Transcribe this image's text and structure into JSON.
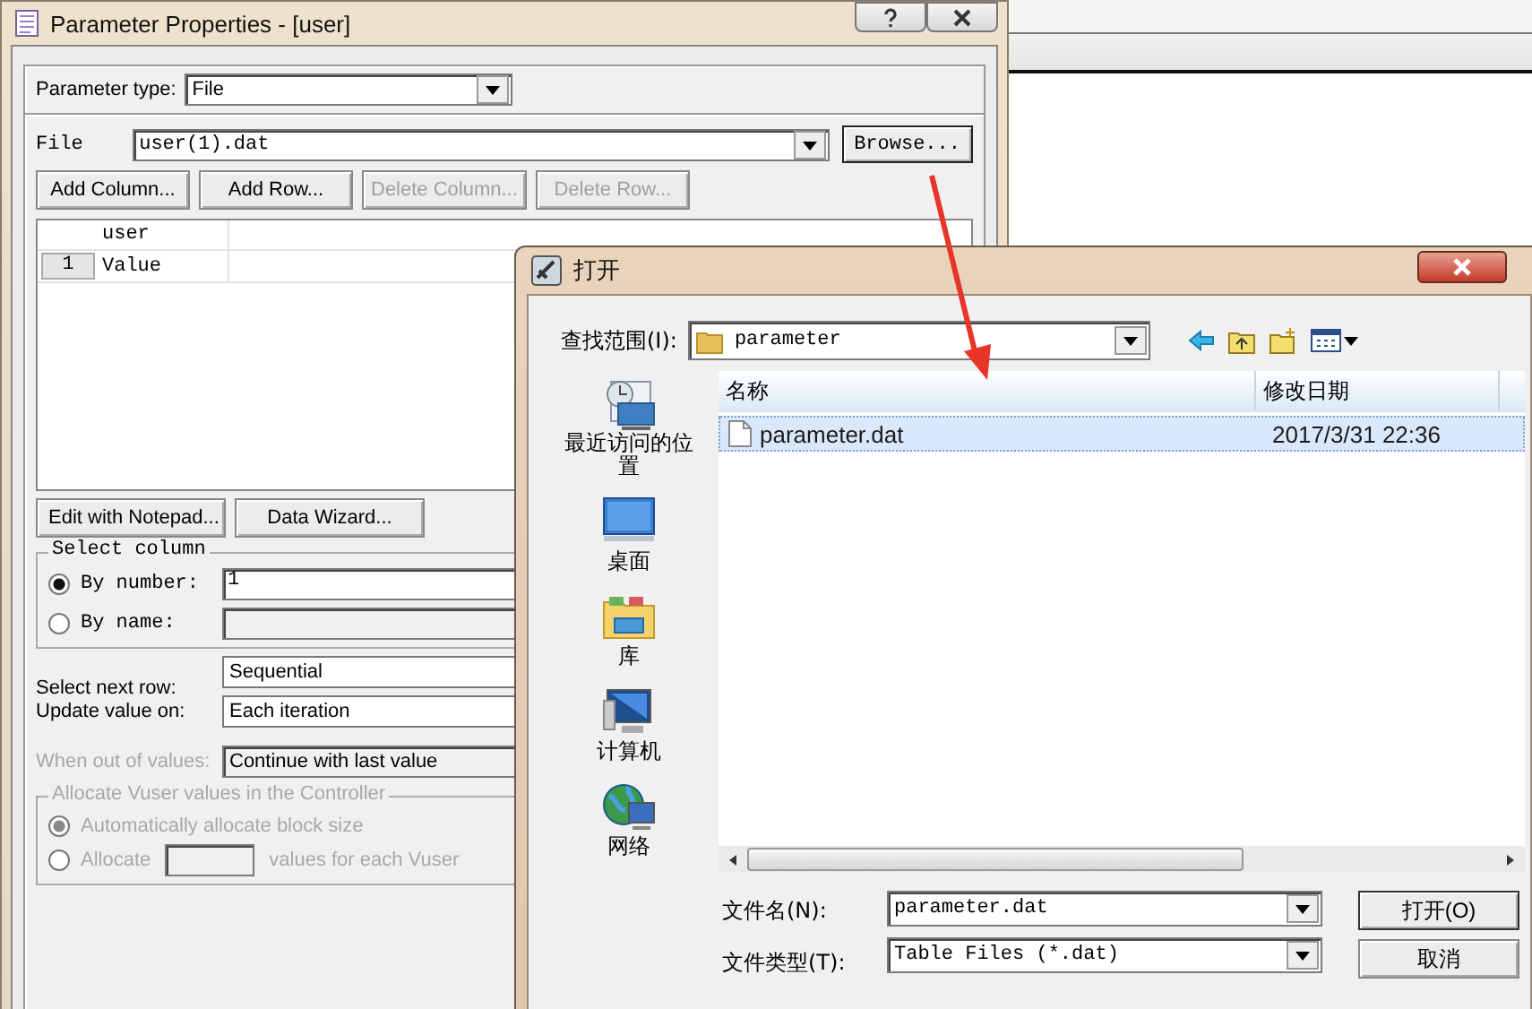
{
  "param_window": {
    "title": "Parameter Properties - [user]",
    "parameter_type": {
      "label": "Parameter type:",
      "value": "File"
    },
    "file": {
      "label": "File",
      "value": "user(1).dat",
      "browse": "Browse..."
    },
    "table_buttons": [
      {
        "label": "Add Column...",
        "disabled": false
      },
      {
        "label": "Add Row...",
        "disabled": false
      },
      {
        "label": "Delete Column...",
        "disabled": true
      },
      {
        "label": "Delete Row...",
        "disabled": true
      }
    ],
    "grid": {
      "columns": [
        "user"
      ],
      "rows": [
        {
          "number": "1",
          "value": "Value"
        }
      ]
    },
    "edit_buttons": [
      "Edit with Notepad...",
      "Data Wizard..."
    ],
    "select_column": {
      "title": "Select column",
      "options": [
        {
          "label": "By number:",
          "selected": true,
          "value": "1"
        },
        {
          "label": "By name:",
          "selected": false
        }
      ]
    },
    "select_next_row": {
      "label": "Select next row:",
      "value": "Sequential"
    },
    "update_value_on": {
      "label": "Update value on:",
      "value": "Each iteration"
    },
    "when_out_of_values": {
      "label": "When out of values:",
      "value": "Continue with last value",
      "disabled": true
    },
    "allocate": {
      "title": "Allocate Vuser values in the Controller",
      "disabled": true,
      "options": [
        {
          "label": "Automatically allocate block size",
          "selected": true
        },
        {
          "label": "Allocate",
          "suffix": "values for each Vuser",
          "selected": false
        }
      ]
    }
  },
  "open_dialog": {
    "title": "打开",
    "look_in": {
      "label": "查找范围(I):",
      "value": "parameter"
    },
    "places": [
      {
        "label": "最近访问的位置",
        "kind": "recent"
      },
      {
        "label": "桌面",
        "kind": "desktop"
      },
      {
        "label": "库",
        "kind": "library"
      },
      {
        "label": "计算机",
        "kind": "computer"
      },
      {
        "label": "网络",
        "kind": "network"
      }
    ],
    "columns": [
      "名称",
      "修改日期"
    ],
    "files": [
      {
        "name": "parameter.dat",
        "modified": "2017/3/31 22:36",
        "selected": true
      }
    ],
    "file_name": {
      "label": "文件名(N):",
      "value": "parameter.dat"
    },
    "file_type": {
      "label": "文件类型(T):",
      "value": "Table Files (*.dat)"
    },
    "buttons": [
      "打开(O)",
      "取消"
    ]
  }
}
